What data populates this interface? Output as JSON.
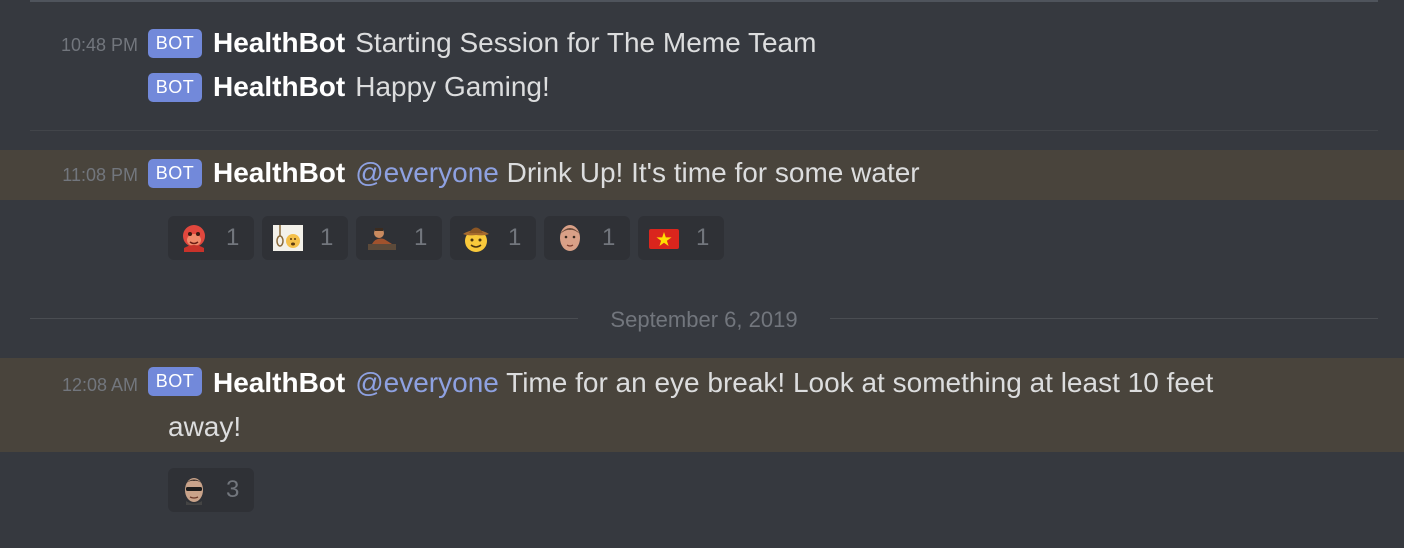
{
  "messages": [
    {
      "timestamp": "10:48 PM",
      "tag": "BOT",
      "author": "HealthBot",
      "text": "Starting Session for The Meme Team"
    },
    {
      "tag": "BOT",
      "author": "HealthBot",
      "text": "Happy Gaming!"
    },
    {
      "timestamp": "11:08 PM",
      "tag": "BOT",
      "author": "HealthBot",
      "mention": "@everyone",
      "text": "Drink Up! It's time for some water",
      "reactions": [
        {
          "icon": "angry-monkey-emoji",
          "count": "1"
        },
        {
          "icon": "noose-face-emoji",
          "count": "1"
        },
        {
          "icon": "reclining-man-emoji",
          "count": "1"
        },
        {
          "icon": "cowboy-face-emoji",
          "count": "1"
        },
        {
          "icon": "man-face-emoji",
          "count": "1"
        },
        {
          "icon": "vietnam-flag-emoji",
          "count": "1"
        }
      ]
    },
    {
      "timestamp": "12:08 AM",
      "tag": "BOT",
      "author": "HealthBot",
      "mention": "@everyone",
      "text_line1": "Time for an eye break! Look at something at least 10 feet",
      "text_line2": "away!",
      "reactions": [
        {
          "icon": "sunglasses-man-emoji",
          "count": "3"
        }
      ]
    }
  ],
  "date_separator": "September 6, 2019",
  "colors": {
    "background": "#36393f",
    "bot_tag": "#7289da",
    "mention": "#8ea1e1",
    "highlight": "#49443c",
    "reaction_bg": "#2f3136"
  }
}
